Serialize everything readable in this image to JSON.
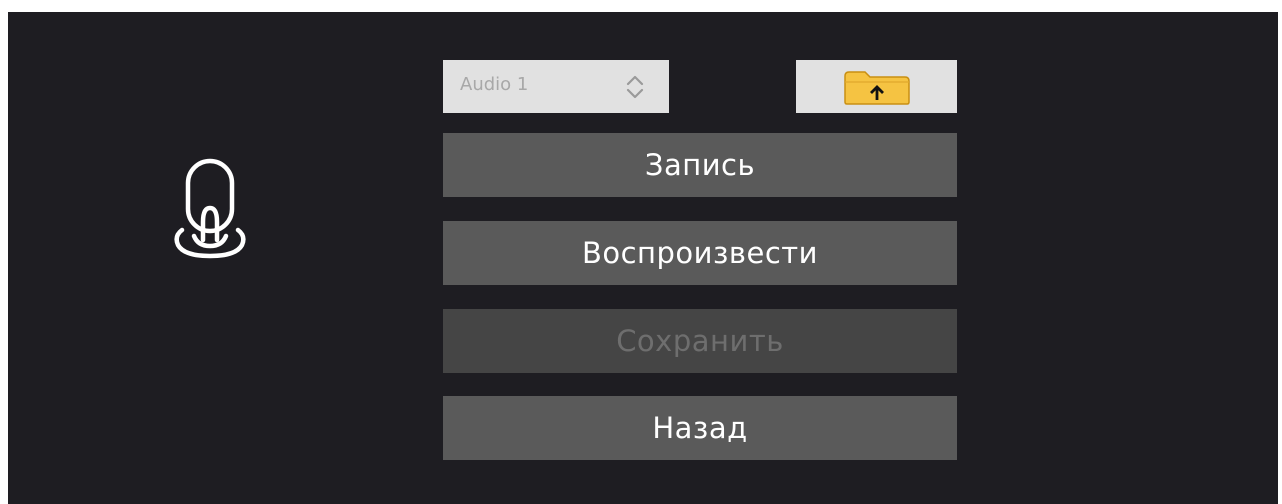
{
  "audio_select": {
    "selected": "Audio 1",
    "icon": "updown-chevron-icon"
  },
  "folder_button": {
    "icon": "folder-upload-icon"
  },
  "microphone": {
    "icon": "microphone-icon"
  },
  "buttons": {
    "record": "Запись",
    "play": "Воспроизвести",
    "save": "Сохранить",
    "back": "Назад"
  },
  "colors": {
    "background": "#1e1d22",
    "button": "#5a5a5a",
    "button_disabled": "#454545",
    "folder": "#f5c342"
  }
}
